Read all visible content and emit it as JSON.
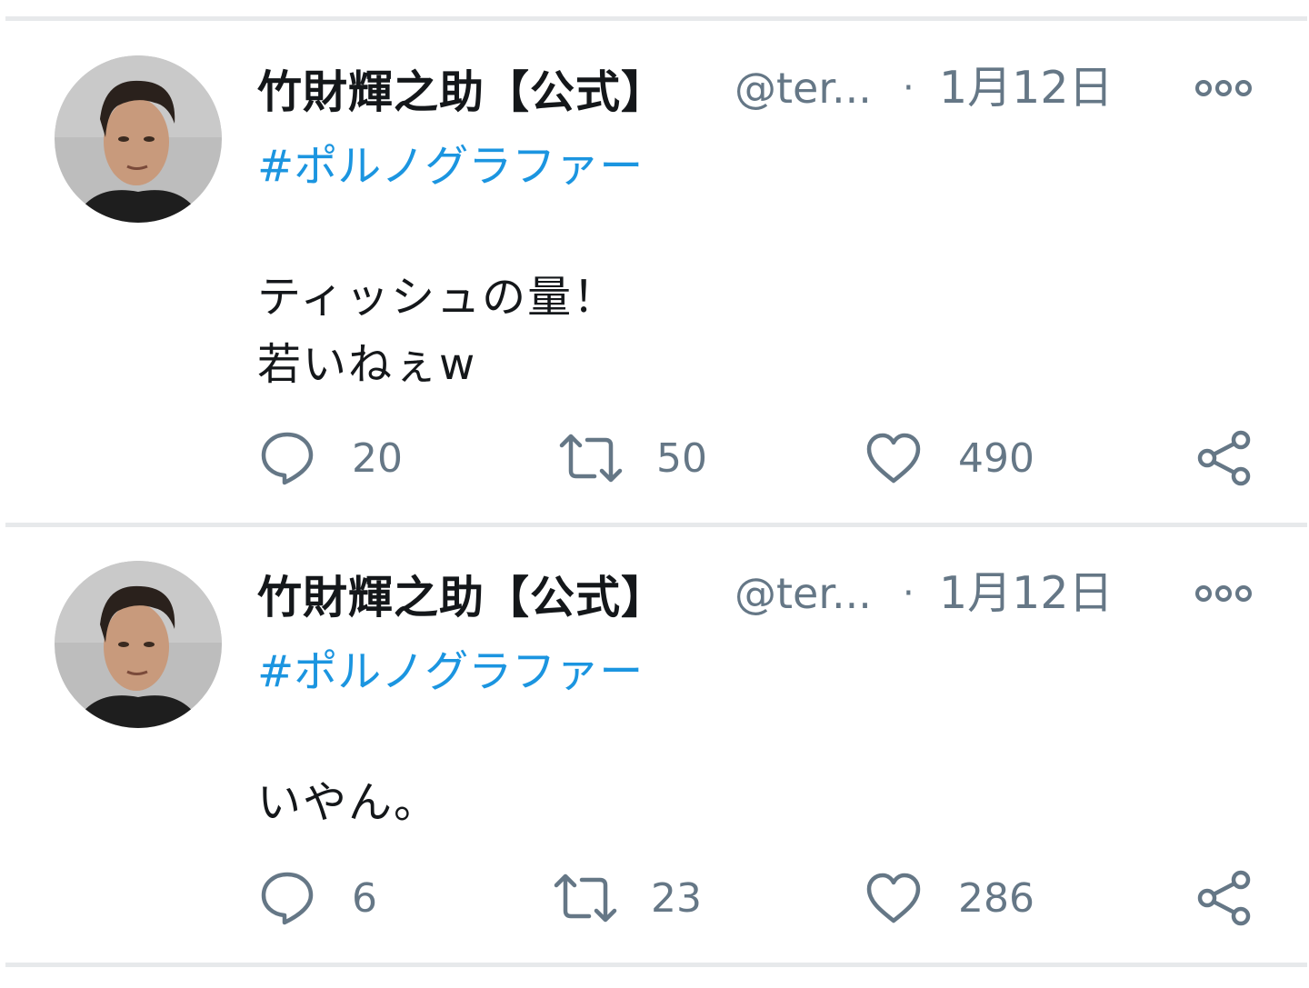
{
  "tweets": [
    {
      "author_name": "竹財輝之助【公式】",
      "handle": "@ter...",
      "separator": "·",
      "date": "1月12日",
      "hashtag": "#ポルノグラファー",
      "text_lines": [
        "ティッシュの量！",
        "若いねぇw"
      ],
      "replies": "20",
      "retweets": "50",
      "likes": "490"
    },
    {
      "author_name": "竹財輝之助【公式】",
      "handle": "@ter...",
      "separator": "·",
      "date": "1月12日",
      "hashtag": "#ポルノグラファー",
      "text_lines": [
        "いやん。"
      ],
      "replies": "6",
      "retweets": "23",
      "likes": "286"
    }
  ],
  "icons": {
    "reply": "reply-icon",
    "retweet": "retweet-icon",
    "like": "heart-icon",
    "share": "share-icon",
    "more": "more-options-icon"
  },
  "colors": {
    "hashtag": "#1b95e0",
    "secondary_text": "#657786",
    "primary_text": "#14171a",
    "divider": "#e7e9eb"
  }
}
